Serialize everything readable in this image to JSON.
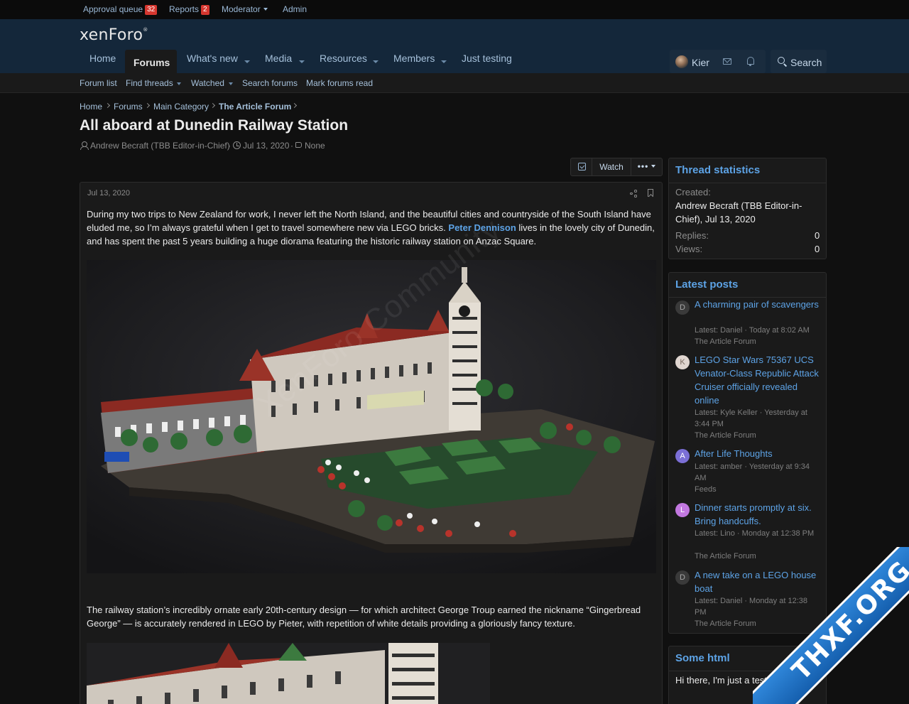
{
  "staffbar": {
    "approval_queue": "Approval queue",
    "approval_count": "32",
    "reports": "Reports",
    "reports_count": "2",
    "moderator": "Moderator",
    "admin": "Admin"
  },
  "header": {
    "logo": "xenForo",
    "nav": {
      "home": "Home",
      "forums": "Forums",
      "whats_new": "What's new",
      "media": "Media",
      "resources": "Resources",
      "members": "Members",
      "just_testing": "Just testing"
    },
    "user": "Kier",
    "search": "Search"
  },
  "subnav": {
    "forum_list": "Forum list",
    "find_threads": "Find threads",
    "watched": "Watched",
    "search_forums": "Search forums",
    "mark_read": "Mark forums read"
  },
  "breadcrumb": {
    "home": "Home",
    "forums": "Forums",
    "main_category": "Main Category",
    "article_forum": "The Article Forum"
  },
  "thread": {
    "title": "All aboard at Dunedin Railway Station",
    "author": "Andrew Becraft (TBB Editor-in-Chief)",
    "date": "Jul 13, 2020",
    "tags": "None",
    "watch": "Watch",
    "more": "•••"
  },
  "post": {
    "date": "Jul 13, 2020",
    "para1_a": "During my two trips to New Zealand for work, I never left the North Island, and the beautiful cities and countryside of the South Island have eluded me, so I’m always grateful when I get to travel somewhere new via LEGO bricks. ",
    "para1_link": "Peter Dennison",
    "para1_b": " lives in the lovely city of Dunedin, and has spent the past 5 years building a huge diorama featuring the historic railway station on Anzac Square.",
    "para2": "The railway station’s incredibly ornate early 20th-century design — for which architect George Troup earned the nickname “Gingerbread George” — is accurately rendered in LEGO by Pieter, with repetition of white details providing a gloriously fancy texture.",
    "watermark": "XenForo Community"
  },
  "stats": {
    "title": "Thread statistics",
    "created_label": "Created:",
    "created_value": "Andrew Becraft (TBB Editor-in-Chief), Jul 13, 2020",
    "replies_label": "Replies:",
    "replies_value": "0",
    "views_label": "Views:",
    "views_value": "0"
  },
  "latest": {
    "title": "Latest posts",
    "items": [
      {
        "initial": "D",
        "title": "A charming pair of scavengers",
        "meta": "Latest: Daniel · Today at 8:02 AM",
        "forum": "The Article Forum",
        "color": "#3a3a3a"
      },
      {
        "initial": "K",
        "title": "LEGO Star Wars 75367 UCS Venator-Class Republic Attack Cruiser officially revealed online",
        "meta": "Latest: Kyle Keller · Yesterday at 3:44 PM",
        "forum": "The Article Forum",
        "color": "#e0d6d0"
      },
      {
        "initial": "A",
        "title": "After Life Thoughts",
        "meta": "Latest: amber · Yesterday at 9:34 AM",
        "forum": "Feeds",
        "color": "#7b6fd6"
      },
      {
        "initial": "L",
        "title": "Dinner starts promptly at six. Bring handcuffs.",
        "meta": "Latest: Lino · Monday at 12:38 PM",
        "forum": "The Article Forum",
        "color": "#c278e0"
      },
      {
        "initial": "D",
        "title": "A new take on a LEGO house boat",
        "meta": "Latest: Daniel · Monday at 12:38 PM",
        "forum": "The Article Forum",
        "color": "#3a3a3a"
      }
    ]
  },
  "somehtml": {
    "title": "Some html",
    "text": "Hi there, I'm just a test"
  },
  "ribbon": "THXF.ORG"
}
